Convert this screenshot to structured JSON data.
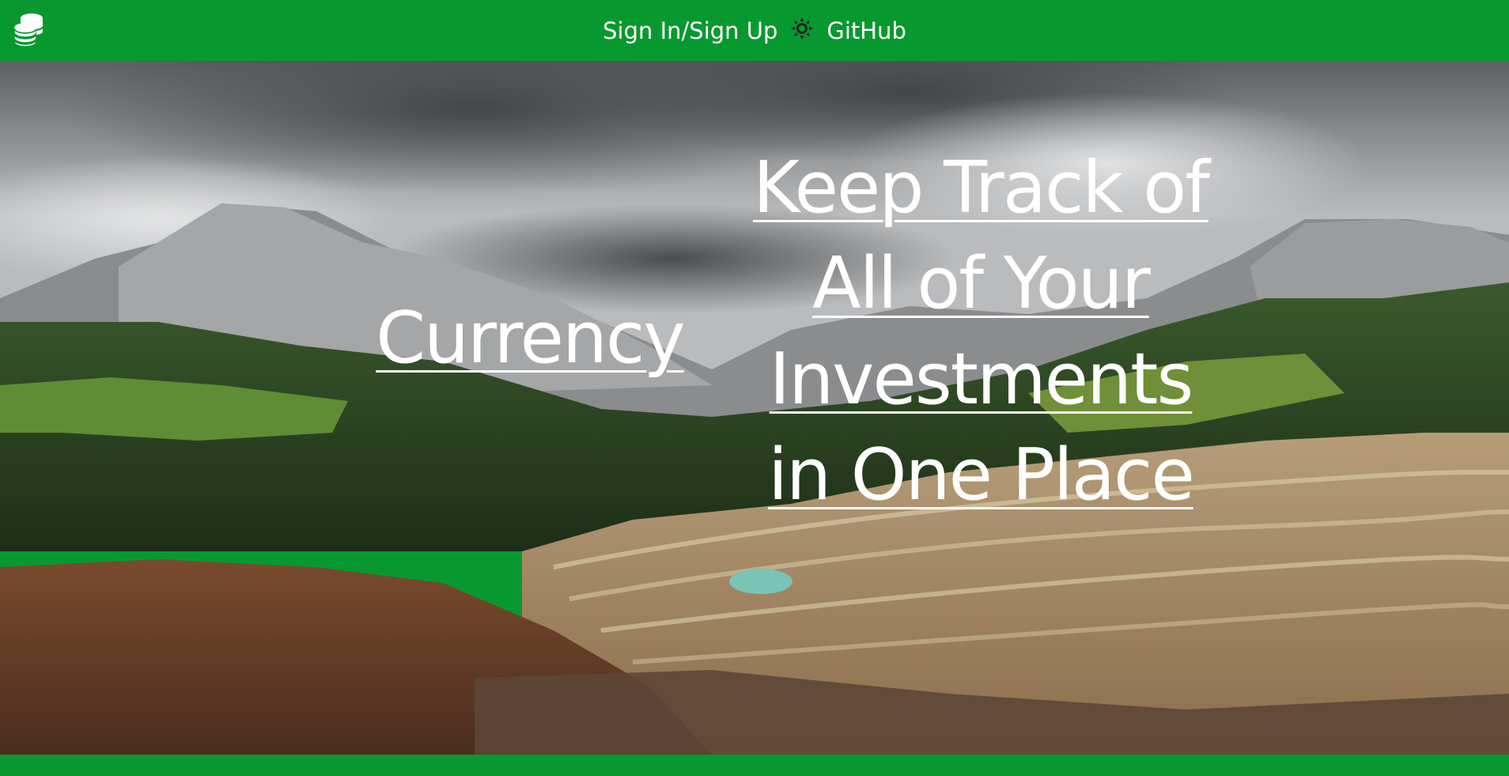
{
  "header": {
    "logo_icon": "coins-stack-icon",
    "nav": {
      "signin_label": "Sign In/Sign Up",
      "theme_icon": "sun-icon",
      "github_label": "GitHub"
    }
  },
  "hero": {
    "background": "mountain-and-open-pit-mine-photo",
    "left_heading": "Currency",
    "right_heading": "Keep Track of All of Your Investments in One Place"
  },
  "colors": {
    "brand_green": "#07992f",
    "text": "#ffffff"
  }
}
